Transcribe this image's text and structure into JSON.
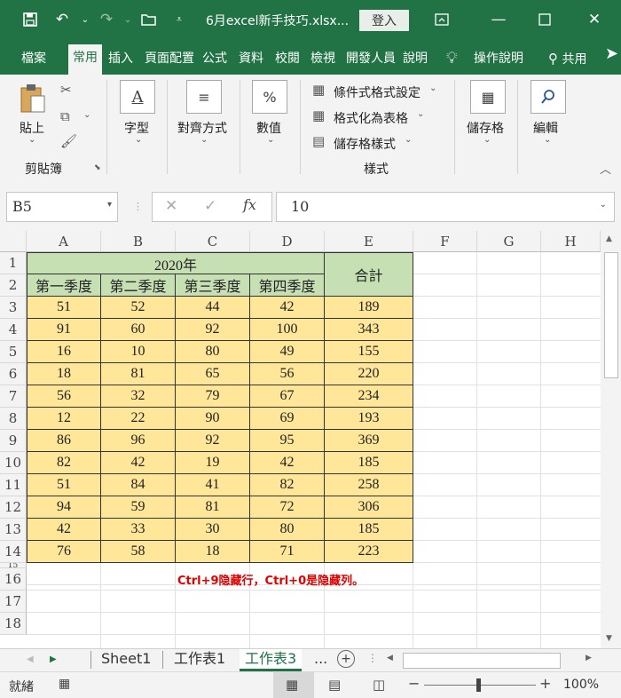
{
  "titlebar": {
    "title": "6月excel新手技巧.xlsx...",
    "login": "登入",
    "colors": {
      "brand": "#217346"
    }
  },
  "tabs": [
    "檔案",
    "常用",
    "插入",
    "頁面配置",
    "公式",
    "資料",
    "校閱",
    "檢視",
    "開發人員",
    "說明"
  ],
  "active_tab": "常用",
  "tell_me": "操作說明",
  "share": "共用",
  "ribbon": {
    "paste": "貼上",
    "clipboard_group": "剪貼簿",
    "font": "字型",
    "alignment": "對齊方式",
    "number": "數值",
    "cond_format": "條件式格式設定",
    "format_table": "格式化為表格",
    "cell_styles": "儲存格樣式",
    "styles_group": "樣式",
    "cells": "儲存格",
    "editing": "編輯"
  },
  "formula_bar": {
    "name_box": "B5",
    "fx": "fx",
    "value": "10"
  },
  "grid": {
    "columns": [
      "A",
      "B",
      "C",
      "D",
      "E",
      "F",
      "G",
      "H"
    ],
    "rows": [
      "1",
      "2",
      "3",
      "4",
      "5",
      "6",
      "7",
      "8",
      "9",
      "10",
      "11",
      "12",
      "13",
      "14",
      "15",
      "16",
      "17",
      "18"
    ],
    "year_header": "2020年",
    "total_header": "合計",
    "quarters": [
      "第一季度",
      "第二季度",
      "第三季度",
      "第四季度"
    ],
    "data": [
      [
        "51",
        "52",
        "44",
        "42",
        "189"
      ],
      [
        "91",
        "60",
        "92",
        "100",
        "343"
      ],
      [
        "16",
        "10",
        "80",
        "49",
        "155"
      ],
      [
        "18",
        "81",
        "65",
        "56",
        "220"
      ],
      [
        "56",
        "32",
        "79",
        "67",
        "234"
      ],
      [
        "12",
        "22",
        "90",
        "69",
        "193"
      ],
      [
        "86",
        "96",
        "92",
        "95",
        "369"
      ],
      [
        "82",
        "42",
        "19",
        "42",
        "185"
      ],
      [
        "51",
        "84",
        "41",
        "82",
        "258"
      ],
      [
        "94",
        "59",
        "81",
        "72",
        "306"
      ],
      [
        "42",
        "33",
        "30",
        "80",
        "185"
      ],
      [
        "76",
        "58",
        "18",
        "71",
        "223"
      ]
    ],
    "note": "Ctrl+9隐藏行，Ctrl+0是隐藏列。",
    "colors": {
      "data_fill": "#ffe699",
      "header_fill": "#c6e0b4",
      "note": "#e00000"
    }
  },
  "sheets": [
    "Sheet1",
    "工作表1",
    "工作表3"
  ],
  "active_sheet": "工作表3",
  "sheets_more": "...",
  "status": {
    "ready": "就緒",
    "zoom": "100%"
  }
}
